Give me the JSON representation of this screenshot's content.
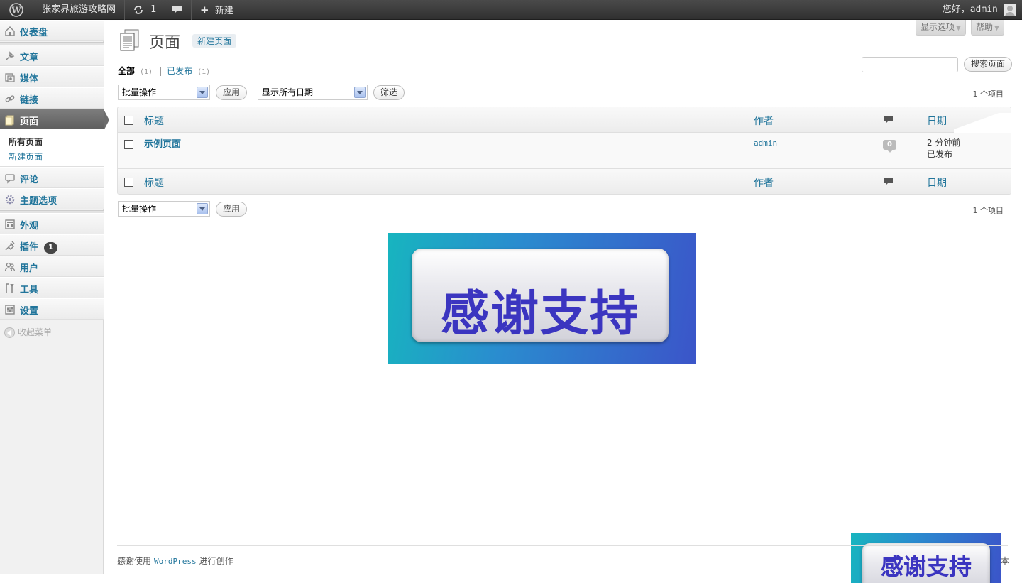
{
  "admin_bar": {
    "site_name": "张家界旅游攻略网",
    "updates_count": "1",
    "new_label": "新建",
    "greeting": "您好，",
    "username": "admin"
  },
  "sidebar": {
    "items": [
      {
        "label": "仪表盘",
        "icon": "dashboard-icon"
      },
      {
        "label": "文章",
        "icon": "pin-icon"
      },
      {
        "label": "媒体",
        "icon": "media-icon"
      },
      {
        "label": "链接",
        "icon": "link-icon"
      },
      {
        "label": "页面",
        "icon": "pages-icon"
      },
      {
        "label": "评论",
        "icon": "comments-icon"
      },
      {
        "label": "主题选项",
        "icon": "gear-icon"
      },
      {
        "label": "外观",
        "icon": "appearance-icon"
      },
      {
        "label": "插件",
        "icon": "plugin-icon",
        "badge": "1"
      },
      {
        "label": "用户",
        "icon": "users-icon"
      },
      {
        "label": "工具",
        "icon": "tools-icon"
      },
      {
        "label": "设置",
        "icon": "settings-icon"
      }
    ],
    "submenu": [
      "所有页面",
      "新建页面"
    ],
    "collapse_label": "收起菜单"
  },
  "screen_meta": {
    "screen_options": "显示选项",
    "help": "帮助"
  },
  "page": {
    "title": "页面",
    "add_new": "新建页面"
  },
  "filters": {
    "all_label": "全部",
    "all_count": "(1)",
    "published_label": "已发布",
    "published_count": "(1)",
    "separator": "|"
  },
  "search": {
    "button": "搜索页面",
    "value": ""
  },
  "tablenav": {
    "bulk_actions": "批量操作",
    "apply": "应用",
    "dates": "显示所有日期",
    "filter": "筛选",
    "items_count": "1 个项目"
  },
  "table": {
    "columns": {
      "title": "标题",
      "author": "作者",
      "date": "日期"
    },
    "rows": [
      {
        "title": "示例页面",
        "author": "admin",
        "comments": "0",
        "date": "2 分钟前",
        "status": "已发布"
      }
    ]
  },
  "banner": {
    "text": "感谢支持",
    "colors": {
      "gradient_start": "#17b5bf",
      "gradient_end": "#3b55c9",
      "text": "#3b35c0"
    }
  },
  "footer": {
    "prefix": "感谢使用",
    "wordpress": "WordPress",
    "suffix": "进行创作",
    "right_fragment": "本"
  },
  "colors": {
    "accent_link": "#21759b",
    "admin_bar": "#464646",
    "current_menu": "#6d6d6d"
  }
}
